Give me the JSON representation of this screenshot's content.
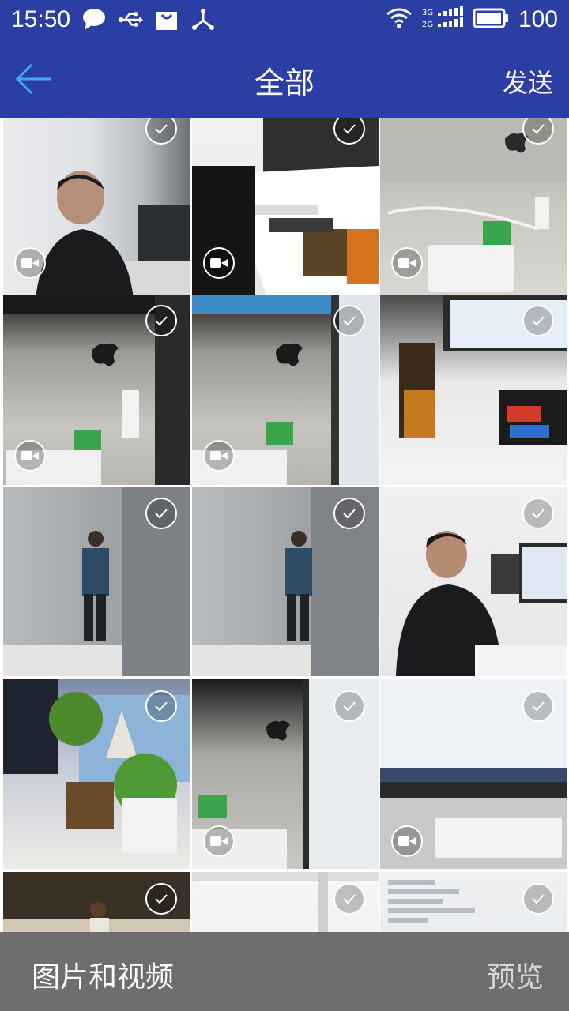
{
  "status_bar": {
    "time": "15:50",
    "battery": "100",
    "icons": [
      "chat-icon",
      "usb-icon",
      "shopping-bag-icon",
      "share-icon",
      "wifi-icon",
      "signal-icon",
      "battery-icon"
    ]
  },
  "header": {
    "back_icon": "arrow-left-icon",
    "title": "全部",
    "send_label": "发送"
  },
  "grid": {
    "items": [
      {
        "type": "video",
        "selected": false
      },
      {
        "type": "video",
        "selected": false
      },
      {
        "type": "video",
        "selected": false
      },
      {
        "type": "video",
        "selected": false
      },
      {
        "type": "video",
        "selected": false
      },
      {
        "type": "photo",
        "selected": false
      },
      {
        "type": "photo",
        "selected": false
      },
      {
        "type": "photo",
        "selected": false
      },
      {
        "type": "photo",
        "selected": false
      },
      {
        "type": "photo",
        "selected": false
      },
      {
        "type": "video",
        "selected": false
      },
      {
        "type": "video",
        "selected": false
      },
      {
        "type": "photo",
        "selected": false
      },
      {
        "type": "photo",
        "selected": false
      },
      {
        "type": "photo",
        "selected": false
      }
    ]
  },
  "footer": {
    "album_label": "图片和视频",
    "preview_label": "预览"
  },
  "colors": {
    "primary": "#2b3ea3",
    "back_arrow": "#3fa9f5",
    "bottom_bar": "#6e6e6e"
  }
}
